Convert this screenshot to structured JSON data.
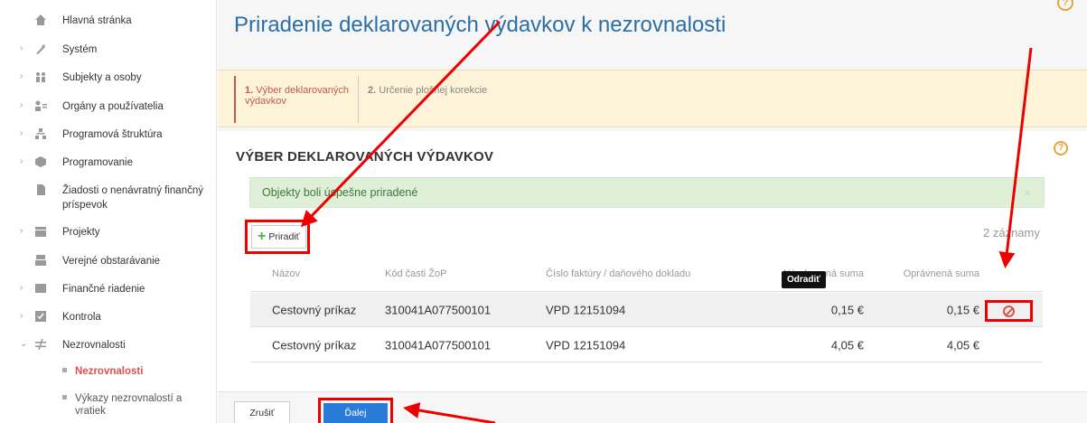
{
  "sidebar": {
    "items": [
      {
        "label": "Hlavná stránka",
        "icon": "home-icon"
      },
      {
        "label": "Systém",
        "icon": "wrench-icon"
      },
      {
        "label": "Subjekty a osoby",
        "icon": "people-icon"
      },
      {
        "label": "Orgány a používatelia",
        "icon": "users-icon"
      },
      {
        "label": "Programová štruktúra",
        "icon": "sitemap-icon"
      },
      {
        "label": "Programovanie",
        "icon": "cubes-icon"
      },
      {
        "label": "Žiadosti o nenávratný finančný príspevok",
        "icon": "document-icon"
      },
      {
        "label": "Projekty",
        "icon": "folder-icon"
      },
      {
        "label": "Verejné obstarávanie",
        "icon": "tray-icon"
      },
      {
        "label": "Finančné riadenie",
        "icon": "finance-icon"
      },
      {
        "label": "Kontrola",
        "icon": "checkbox-icon"
      },
      {
        "label": "Nezrovnalosti",
        "icon": "not-equal-icon"
      }
    ],
    "subitems": [
      {
        "label": "Nezrovnalosti",
        "active": true
      },
      {
        "label": "Výkazy nezrovnalostí a vratiek",
        "active": false
      }
    ]
  },
  "page": {
    "title": "Priradenie deklarovaných výdavkov k nezrovnalosti"
  },
  "wizard": {
    "step1_num": "1.",
    "step1_label": "Výber deklarovaných výdavkov",
    "step2_num": "2.",
    "step2_label": "Určenie plošnej korekcie"
  },
  "section": {
    "title": "VÝBER DEKLAROVANÝCH VÝDAVKOV"
  },
  "alert": {
    "message": "Objekty boli úspešne priradené",
    "close": "×"
  },
  "toolbar": {
    "add_label": "Priradiť",
    "count": "2 záznamy"
  },
  "table": {
    "headers": [
      "Názov",
      "Kód časti ŽoP",
      "Číslo faktúry / daňového dokladu",
      "Nárokovaná suma",
      "Oprávnená suma"
    ],
    "rows": [
      [
        "Cestovný príkaz",
        "310041A077500101",
        "VPD 12151094",
        "0,15 €",
        "0,15 €"
      ],
      [
        "Cestovný príkaz",
        "310041A077500101",
        "VPD 12151094",
        "4,05 €",
        "4,05 €"
      ]
    ]
  },
  "tooltip": {
    "text": "Odradiť"
  },
  "footer": {
    "cancel_label": "Zrušiť",
    "next_label": "Ďalej"
  },
  "colors": {
    "title_blue": "#2a6fa8",
    "annotation_red": "#e00000",
    "accent_orange": "#e8a33d"
  }
}
